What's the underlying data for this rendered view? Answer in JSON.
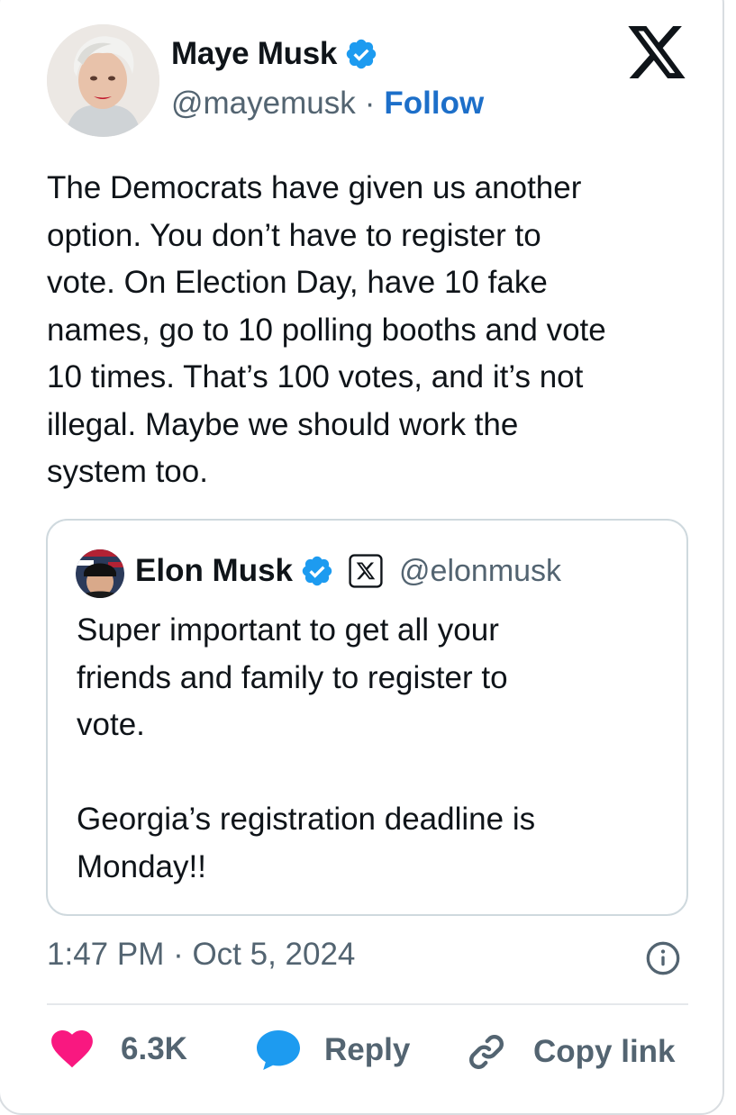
{
  "tweet": {
    "author": {
      "name": "Maye Musk",
      "handle": "@mayemusk",
      "separator": "·",
      "follow_label": "Follow",
      "avatar_icon": "avatar-photo",
      "verified_icon": "verified-badge-icon"
    },
    "platform_icon": "x-logo-icon",
    "text": "The Democrats have given us another\noption. You don’t have to register to\nvote. On Election Day, have 10 fake\nnames, go to 10 polling booths and vote\n10 times. That’s 100 votes, and it’s not\nillegal. Maybe we should work the\nsystem too.",
    "quoted": {
      "name": "Elon Musk",
      "handle": "@elonmusk",
      "verified_icon": "verified-badge-icon",
      "affiliation_icon": "x-badge-icon",
      "text": "Super important to get all your\nfriends and family to register to\nvote.\n\nGeorgia’s registration deadline is\nMonday!!"
    },
    "timestamp": "1:47 PM · Oct 5, 2024",
    "actions": {
      "like_count": "6.3K",
      "reply_label": "Reply",
      "copy_link_label": "Copy link"
    },
    "colors": {
      "accent": "#1d9bf0",
      "follow": "#1d6fc9",
      "like": "#f91880",
      "muted": "#536471",
      "text": "#0f1419"
    }
  }
}
